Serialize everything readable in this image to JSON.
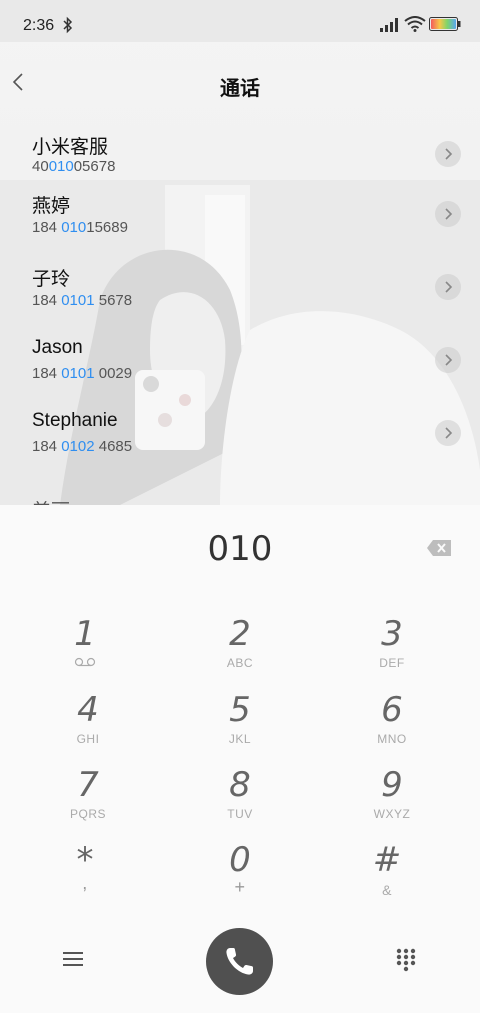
{
  "status_bar": {
    "time": "2:36"
  },
  "header": {
    "title": "通话"
  },
  "contacts": [
    {
      "name": "小米客服",
      "number_pre": "40",
      "number_match": "010",
      "number_post": "05678"
    },
    {
      "name": "燕婷",
      "number_pre": "184 ",
      "number_match": "010",
      "number_post": "15689"
    },
    {
      "name": "子玲",
      "number_pre": "184 ",
      "number_match": "0101",
      "number_post": " 5678"
    },
    {
      "name": "Jason",
      "number_pre": "184 ",
      "number_match": "0101",
      "number_post": " 0029"
    },
    {
      "name": "Stephanie",
      "number_pre": "184 ",
      "number_match": "0102",
      "number_post": " 4685"
    }
  ],
  "partial_contact": {
    "name": "美丽"
  },
  "dialer": {
    "dialed": "010",
    "keys": [
      {
        "digit": "1",
        "letters": ""
      },
      {
        "digit": "2",
        "letters": "ABC"
      },
      {
        "digit": "3",
        "letters": "DEF"
      },
      {
        "digit": "4",
        "letters": "GHI"
      },
      {
        "digit": "5",
        "letters": "JKL"
      },
      {
        "digit": "6",
        "letters": "MNO"
      },
      {
        "digit": "7",
        "letters": "PQRS"
      },
      {
        "digit": "8",
        "letters": "TUV"
      },
      {
        "digit": "9",
        "letters": "WXYZ"
      },
      {
        "digit": "*",
        "letters": ","
      },
      {
        "digit": "0",
        "letters": "+"
      },
      {
        "digit": "#",
        "letters": "&"
      }
    ]
  },
  "icons": {
    "bluetooth": "bluetooth-icon",
    "signal": "signal-icon",
    "wifi": "wifi-icon",
    "battery": "battery-icon",
    "back": "back-arrow-icon",
    "chevron": "chevron-right-icon",
    "backspace": "backspace-icon",
    "voicemail": "voicemail-icon",
    "menu": "menu-icon",
    "call": "phone-icon",
    "dialpad": "dialpad-icon"
  },
  "colors": {
    "match_highlight": "#2f8ef0",
    "call_button": "#505050"
  }
}
